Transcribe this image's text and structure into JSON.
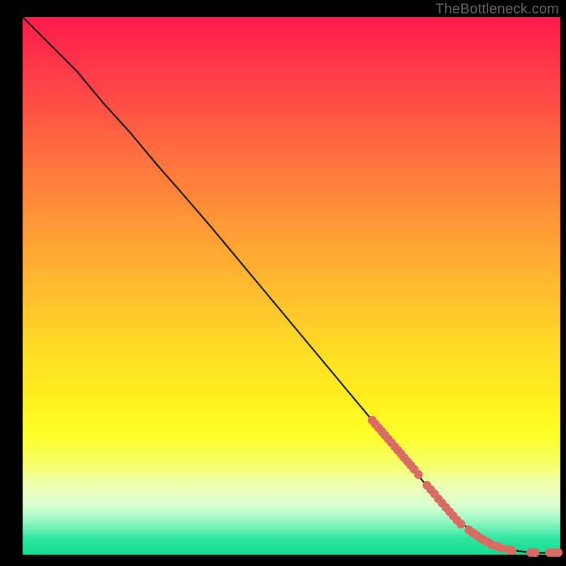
{
  "watermark": "TheBottleneck.com",
  "colors": {
    "dot": "#d96b63",
    "curve": "#141414"
  },
  "chart_data": {
    "type": "line",
    "title": "",
    "xlabel": "",
    "ylabel": "",
    "xlim": [
      0,
      100
    ],
    "ylim": [
      0,
      100
    ],
    "grid": false,
    "series": [
      {
        "name": "curve",
        "x": [
          0,
          3,
          6,
          10,
          15,
          20,
          25,
          30,
          35,
          40,
          45,
          50,
          55,
          60,
          65,
          70,
          75,
          80,
          82,
          84,
          86,
          88,
          90,
          92,
          94,
          96,
          98,
          100
        ],
        "y": [
          100,
          97,
          94,
          90,
          84,
          78.5,
          72.5,
          66.8,
          61,
          55,
          49,
          43,
          37,
          31,
          25,
          19,
          13,
          7.5,
          5.6,
          4.0,
          2.8,
          1.9,
          1.2,
          0.7,
          0.45,
          0.35,
          0.35,
          0.35
        ]
      }
    ],
    "scatter": [
      {
        "name": "cluster-upper-dense",
        "x": [
          65.0,
          65.6,
          66.2,
          66.8,
          67.4,
          68.0,
          68.6,
          69.2,
          69.8,
          70.4,
          71.0,
          71.6,
          72.2,
          72.8
        ],
        "y": [
          25.0,
          24.3,
          23.6,
          22.9,
          22.2,
          21.5,
          20.8,
          20.1,
          19.4,
          18.7,
          18.0,
          17.3,
          16.6,
          15.9
        ]
      },
      {
        "name": "single-gap-dot",
        "x": [
          73.6
        ],
        "y": [
          14.9
        ]
      },
      {
        "name": "cluster-mid",
        "x": [
          75.2,
          75.9,
          76.6,
          77.3,
          78.0,
          78.7,
          79.4,
          80.1,
          80.8,
          81.5
        ],
        "y": [
          12.9,
          12.1,
          11.3,
          10.4,
          9.6,
          8.8,
          8.0,
          7.2,
          6.4,
          5.7
        ]
      },
      {
        "name": "cluster-low-dense",
        "x": [
          83.0,
          83.7,
          84.4,
          85.1,
          85.8,
          86.5,
          87.2
        ],
        "y": [
          4.6,
          4.1,
          3.6,
          3.1,
          2.7,
          2.3,
          1.9
        ]
      },
      {
        "name": "tail-pair-1",
        "x": [
          88.3,
          89.0
        ],
        "y": [
          1.55,
          1.25
        ]
      },
      {
        "name": "tail-pair-2",
        "x": [
          90.3,
          91.0
        ],
        "y": [
          0.95,
          0.75
        ]
      },
      {
        "name": "tail-flat-1",
        "x": [
          94.5,
          95.3
        ],
        "y": [
          0.4,
          0.4
        ]
      },
      {
        "name": "tail-flat-2",
        "x": [
          98.0,
          98.8,
          99.6
        ],
        "y": [
          0.4,
          0.4,
          0.4
        ]
      }
    ]
  }
}
